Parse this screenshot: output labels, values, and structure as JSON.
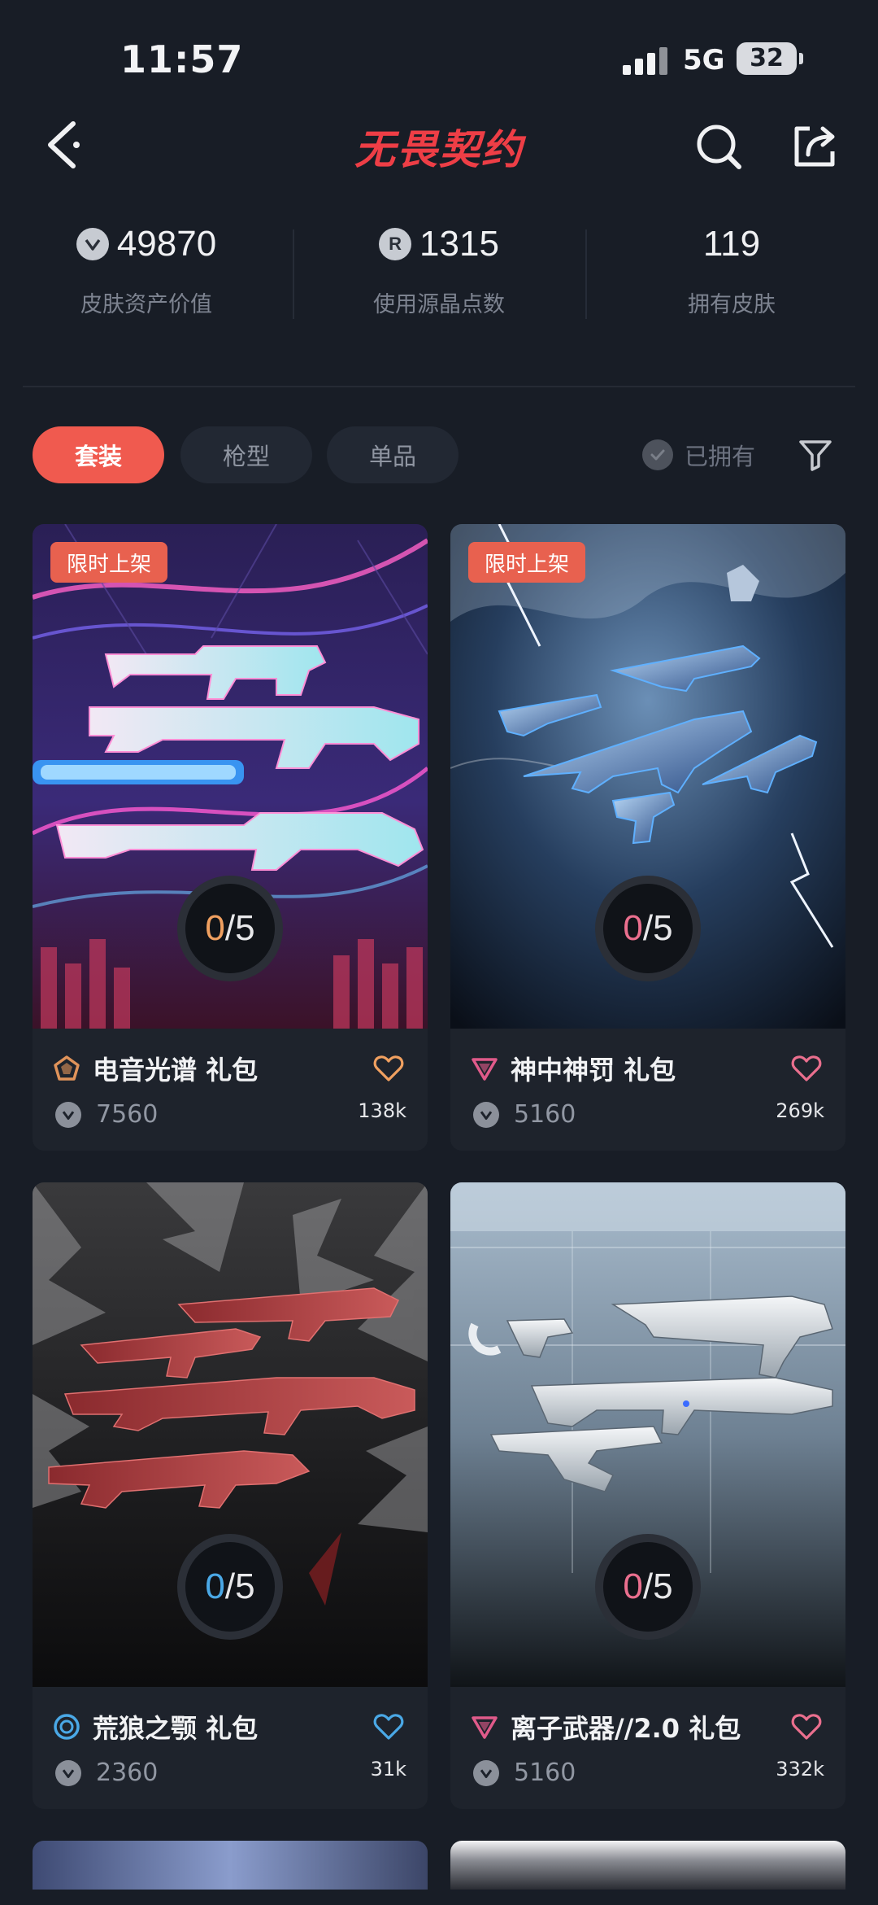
{
  "status_bar": {
    "time": "11:57",
    "network": "5G",
    "battery": "32"
  },
  "header": {
    "title": "无畏契约"
  },
  "stats": [
    {
      "value": "49870",
      "label": "皮肤资产价值",
      "icon": "vp-coin-icon"
    },
    {
      "value": "1315",
      "label": "使用源晶点数",
      "icon": "radianite-icon"
    },
    {
      "value": "119",
      "label": "拥有皮肤",
      "icon": ""
    }
  ],
  "filters": {
    "tabs": [
      {
        "label": "套装",
        "active": true
      },
      {
        "label": "枪型",
        "active": false
      },
      {
        "label": "单品",
        "active": false
      }
    ],
    "owned_label": "已拥有"
  },
  "bundles": [
    {
      "badge": "限时上架",
      "progress_owned": "0",
      "progress_sep": "/",
      "progress_total": "5",
      "name": "电音光谱 礼包",
      "price": "7560",
      "likes": "138k",
      "tier_color": "#e0935a",
      "accent": "#f0a060"
    },
    {
      "badge": "限时上架",
      "progress_owned": "0",
      "progress_sep": "/",
      "progress_total": "5",
      "name": "神中神罚 礼包",
      "price": "5160",
      "likes": "269k",
      "tier_color": "#e05a8a",
      "accent": "#ea6f8e"
    },
    {
      "badge": "",
      "progress_owned": "0",
      "progress_sep": "/",
      "progress_total": "5",
      "name": "荒狼之颚 礼包",
      "price": "2360",
      "likes": "31k",
      "tier_color": "#4aa8e6",
      "accent": "#4aa8e6"
    },
    {
      "badge": "",
      "progress_owned": "0",
      "progress_sep": "/",
      "progress_total": "5",
      "name": "离子武器//2.0 礼包",
      "price": "5160",
      "likes": "332k",
      "tier_color": "#e05a8a",
      "accent": "#ea6f8e"
    }
  ],
  "colors": {
    "background": "#181d26",
    "brand_red": "#ee3e46",
    "active_tab": "#f05a4f"
  }
}
